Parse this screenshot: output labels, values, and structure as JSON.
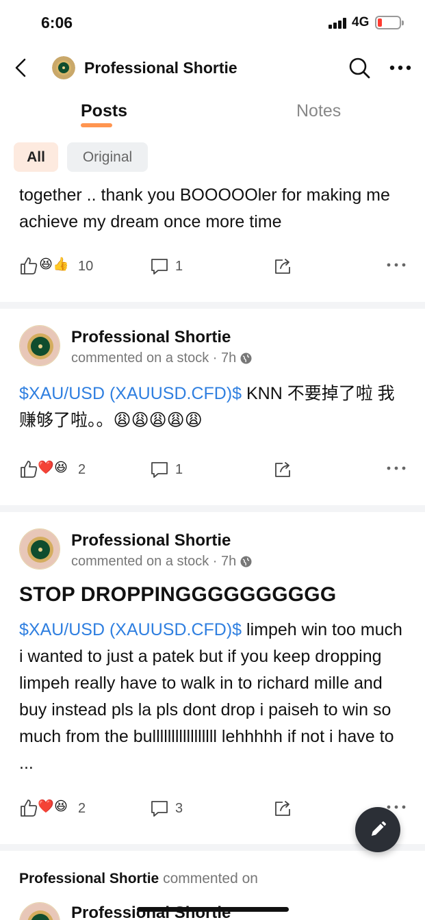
{
  "status_bar": {
    "time": "6:06",
    "network": "4G"
  },
  "nav": {
    "title": "Professional Shortie"
  },
  "tabs": [
    {
      "label": "Posts",
      "active": true
    },
    {
      "label": "Notes",
      "active": false
    }
  ],
  "filters": [
    {
      "label": "All",
      "active": true
    },
    {
      "label": "Original",
      "active": false
    }
  ],
  "posts": [
    {
      "text": "together .. thank you BOOOOOler for making me achieve my dream once more time",
      "reactions": [
        "thumb-up",
        "grinning-squint",
        "thumbs-up-emoji"
      ],
      "like_count": "10",
      "comment_count": "1"
    },
    {
      "author": "Professional Shortie",
      "meta": "commented on a stock · 7h",
      "ticker": "$XAU/USD (XAUUSD.CFD)$",
      "text": " KNN 不要掉了啦 我赚够了啦。。😩😩😩😩😩",
      "reactions": [
        "thumb-up",
        "red-heart",
        "grinning-squint"
      ],
      "like_count": "2",
      "comment_count": "1"
    },
    {
      "author": "Professional Shortie",
      "meta": "commented on a stock · 7h",
      "headline": "STOP DROPPINGGGGGGGGGG",
      "ticker": "$XAU/USD (XAUUSD.CFD)$",
      "text": " limpeh win too much i wanted to just a patek but if you keep dropping limpeh really have to walk in to richard mille and buy instead pls la pls dont drop i paiseh to win so much from the bulllllllllllllllll lehhhhh if not i have to ...",
      "reactions": [
        "thumb-up",
        "red-heart",
        "grinning-squint"
      ],
      "like_count": "2",
      "comment_count": "3"
    }
  ],
  "bottom_snippet": {
    "author": "Professional Shortie",
    "meta": "commented on"
  },
  "bottom_author": "Professional Shortie",
  "colors": {
    "accent": "#ff8a3d",
    "ticker": "#2f7fe0",
    "fab": "#2b2f36"
  }
}
